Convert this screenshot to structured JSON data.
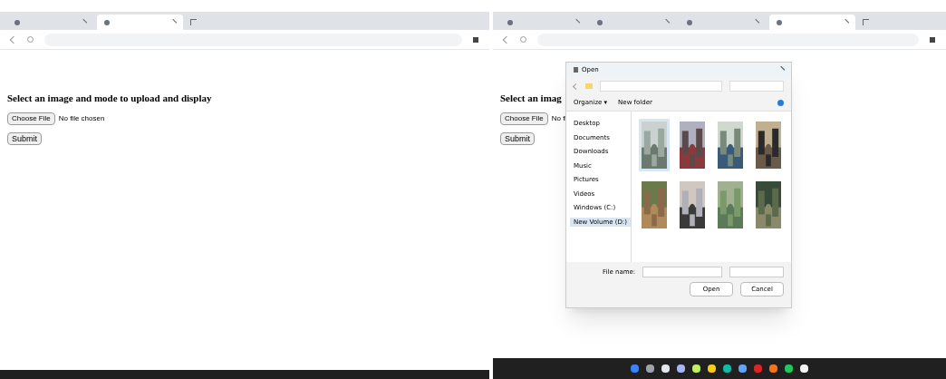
{
  "left_browser": {
    "tabs": [
      {
        "selected": false
      },
      {
        "selected": true
      }
    ],
    "page": {
      "heading": "Select an image and mode to upload and display",
      "file_button": "Choose File",
      "file_status": "No file chosen",
      "submit": "Submit"
    }
  },
  "right_browser": {
    "tabs": [
      {
        "selected": false
      },
      {
        "selected": false
      },
      {
        "selected": false
      },
      {
        "selected": true
      }
    ],
    "page": {
      "heading": "Select an imag",
      "file_button": "Choose File",
      "file_status": "No fi",
      "submit": "Submit"
    }
  },
  "open_dialog": {
    "title": "Open",
    "organize": "Organize ▾",
    "new_folder": "New folder",
    "sidebar": [
      {
        "label": "Desktop",
        "selected": false
      },
      {
        "label": "Documents",
        "selected": false
      },
      {
        "label": "Downloads",
        "selected": false
      },
      {
        "label": "Music",
        "selected": false
      },
      {
        "label": "Pictures",
        "selected": false
      },
      {
        "label": "Videos",
        "selected": false
      },
      {
        "label": "Windows (C:)",
        "selected": false
      },
      {
        "label": "New Volume (D:)",
        "selected": true
      }
    ],
    "files": [
      {
        "kind": "picture",
        "selected": true
      },
      {
        "kind": "picture",
        "selected": false
      },
      {
        "kind": "picture",
        "selected": false
      },
      {
        "kind": "picture",
        "selected": false
      },
      {
        "kind": "picture",
        "selected": false
      },
      {
        "kind": "picture",
        "selected": false
      },
      {
        "kind": "picture",
        "selected": false
      },
      {
        "kind": "picture",
        "selected": false
      }
    ],
    "file_name_label": "File name:",
    "open": "Open",
    "cancel": "Cancel"
  }
}
